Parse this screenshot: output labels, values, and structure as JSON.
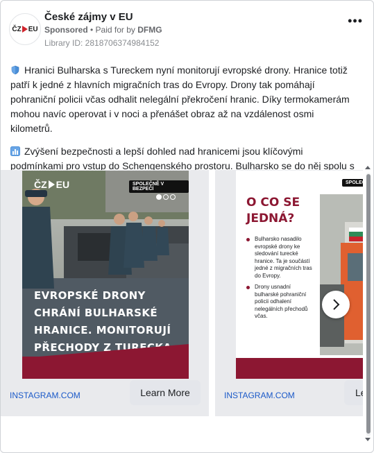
{
  "page": {
    "name": "České zájmy v EU",
    "sponsored": "Sponsored",
    "paid_for_prefix": "• Paid for by",
    "paid_for_by": "DFMG",
    "library_id": "Library ID: 2818706374984152",
    "more_label": "•••"
  },
  "post": {
    "paragraph1": "Hranici Bulharska s Tureckem nyní monitorují evropské drony. Hranice totiž patří k jedné z hlavních migračních tras do Evropy. Drony tak pomáhají pohraniční policii včas odhalit nelegální překročení hranic. Díky termokamerám mohou navíc operovat i v noci a přenášet obraz až na vzdálenost osmi kilometrů.",
    "paragraph2": "Zvýšení bezpečnosti a lepší dohled nad hranicemi jsou klíčovými podmínkami pro vstup do Schengenského prostoru. Bulharsko se do něj spolu s Rumunskem…"
  },
  "carousel": {
    "cards": [
      {
        "ad_logo_left": "ČZ",
        "ad_logo_right": "EU",
        "ribbon": "SPOLEČNĚ V BEZPEČÍ",
        "headline": "Evropské drony chrání bulharské hranice. Monitorují přechody z Turecka",
        "source": "INSTAGRAM.COM",
        "cta": "Learn More"
      },
      {
        "ribbon": "SPOLEČ",
        "heading": "O CO SE JEDNÁ?",
        "bullets": [
          "Bulharsko nasadilo evropské drony ke sledování turecké hranice. Ta je součástí jedné z migračních tras do Evropy.",
          "Drony usnadní bulharské pohraniční policii odhalení nelegálních přechodů včas."
        ],
        "source": "INSTAGRAM.COM",
        "cta": "Le"
      }
    ]
  },
  "logo": {
    "left": "ČZ",
    "right": "EU"
  },
  "colors": {
    "accent": "#8c1732",
    "link": "#1a59c8",
    "logo_arrow": "#d1242c"
  },
  "icons": {
    "shield": "shield-icon",
    "next": "chevron-right-icon"
  }
}
